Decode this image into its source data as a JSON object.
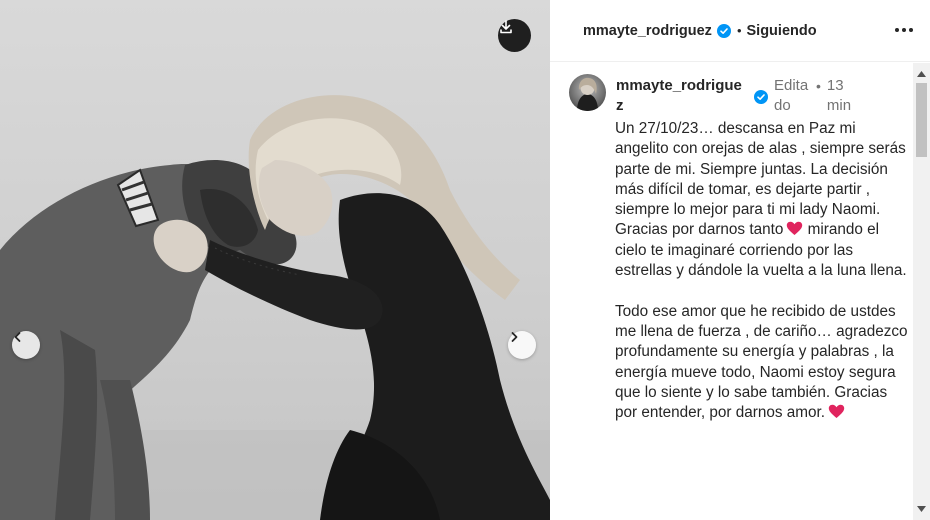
{
  "photo": {
    "alt_icons": {
      "download": "download-icon",
      "prev": "chevron-left-icon",
      "next": "chevron-right-icon"
    }
  },
  "header": {
    "username": "mmayte_rodriguez",
    "separator": "•",
    "follow_label": "Siguiendo",
    "more_icon": "more-horizontal-icon",
    "verified_color": "#0095f6"
  },
  "post": {
    "username": "mmayte_rodriguez",
    "edited_label": "Editado",
    "separator": "•",
    "time": "13 min",
    "caption_paragraph_1": "Un 27/10/23… descansa en Paz mi angelito con orejas de alas , siempre serás parte de mi. Siempre juntas. La decisión más difícil de tomar, es dejarte partir , siempre lo mejor para ti mi lady Naomi. Gracias por darnos tanto",
    "caption_paragraph_1b": "mirando el cielo te imaginaré corriendo por las estrellas y dándole la vuelta a la luna llena.",
    "caption_paragraph_2": "Todo ese amor que he recibido de ustdes me llena de fuerza , de cariño… agradezco profundamente su energía y palabras , la energía mueve todo, Naomi estoy segura que lo siente y lo sabe también. Gracias por entender, por darnos amor.",
    "heart_color": "#e0245e"
  }
}
